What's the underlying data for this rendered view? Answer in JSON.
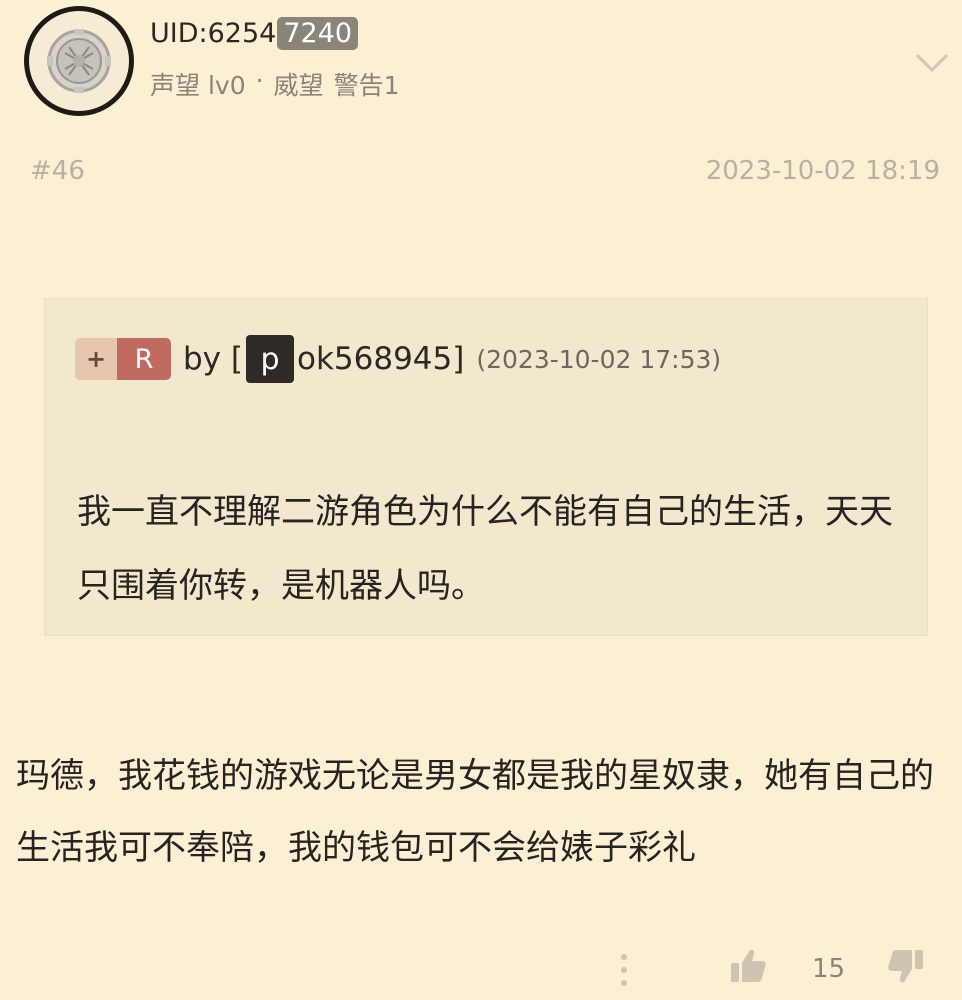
{
  "user": {
    "uid_prefix": "UID:6254",
    "uid_highlight": "7240",
    "reputation": "声望 lv0",
    "separator": "·",
    "prestige": "威望",
    "warning": "警告1"
  },
  "post": {
    "floor": "#46",
    "time": "2023-10-02 18:19"
  },
  "quote": {
    "plus_label": "+",
    "r_label": "R",
    "by_label": "by [",
    "redacted_char": "p",
    "author_rest": "ok568945]",
    "time": "(2023-10-02 17:53)",
    "text": "我一直不理解二游角色为什么不能有自己的生活，天天只围着你转，是机器人吗。"
  },
  "reply": {
    "text": "玛德，我花钱的游戏无论是男女都是我的星奴隶，她有自己的生活我可不奉陪，我的钱包可不会给婊子彩礼"
  },
  "footer": {
    "like_count": "15"
  },
  "colors": {
    "background": "#fbf0d4",
    "quote_background": "#f2e8ce",
    "r_badge": "#c06a60",
    "muted_text": "#b8b0a1"
  }
}
